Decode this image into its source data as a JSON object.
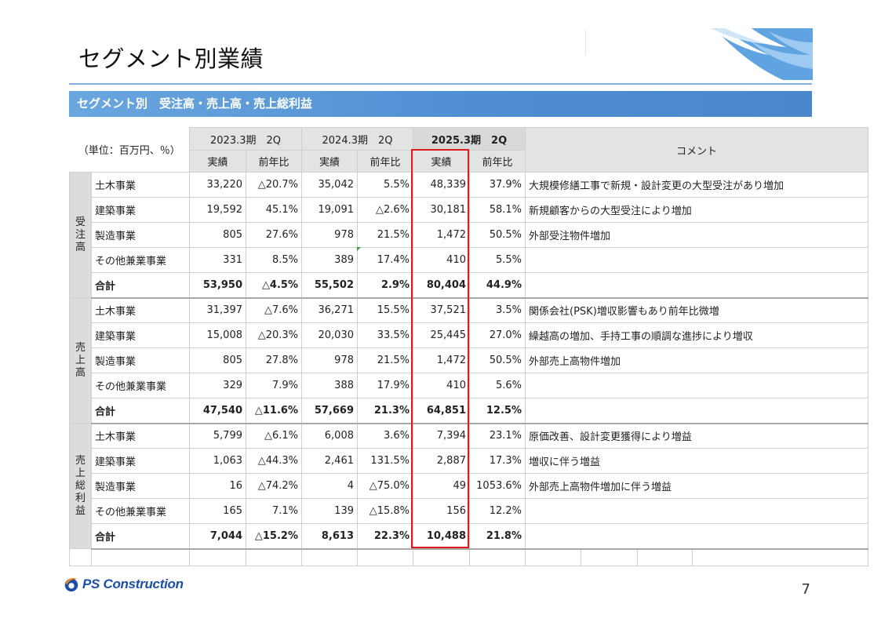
{
  "page": {
    "title": "セグメント別業績",
    "page_number": "7"
  },
  "section": {
    "heading": "セグメント別　受注高・売上高・売上総利益"
  },
  "table": {
    "unit_note": "（単位：百万円、％）",
    "periods": [
      "2023.3期　2Q",
      "2024.3期　2Q",
      "2025.3期　2Q"
    ],
    "sub_headers": {
      "actual": "実績",
      "yoy": "前年比"
    },
    "comment_header": "コメント",
    "groups": [
      {
        "label": "受注高",
        "rows": [
          {
            "segment": "土木事業",
            "v": [
              "33,220",
              "△20.7%",
              "35,042",
              "5.5%",
              "48,339",
              "37.9%"
            ],
            "comment": "大規模修繕工事で新規・設計変更の大型受注があり増加"
          },
          {
            "segment": "建築事業",
            "v": [
              "19,592",
              "45.1%",
              "19,091",
              "△2.6%",
              "30,181",
              "58.1%"
            ],
            "comment": "新規顧客からの大型受注により増加"
          },
          {
            "segment": "製造事業",
            "v": [
              "805",
              "27.6%",
              "978",
              "21.5%",
              "1,472",
              "50.5%"
            ],
            "comment": "外部受注物件増加"
          },
          {
            "segment": "その他兼業事業",
            "v": [
              "331",
              "8.5%",
              "389",
              "17.4%",
              "410",
              "5.5%"
            ],
            "comment": ""
          }
        ],
        "total": {
          "segment": "合計",
          "v": [
            "53,950",
            "△4.5%",
            "55,502",
            "2.9%",
            "80,404",
            "44.9%"
          ],
          "comment": ""
        }
      },
      {
        "label": "売上高",
        "rows": [
          {
            "segment": "土木事業",
            "v": [
              "31,397",
              "△7.6%",
              "36,271",
              "15.5%",
              "37,521",
              "3.5%"
            ],
            "comment": "関係会社(PSK)増収影響もあり前年比微増"
          },
          {
            "segment": "建築事業",
            "v": [
              "15,008",
              "△20.3%",
              "20,030",
              "33.5%",
              "25,445",
              "27.0%"
            ],
            "comment": "繰越高の増加、手持工事の順調な進捗により増収"
          },
          {
            "segment": "製造事業",
            "v": [
              "805",
              "27.8%",
              "978",
              "21.5%",
              "1,472",
              "50.5%"
            ],
            "comment": "外部売上高物件増加"
          },
          {
            "segment": "その他兼業事業",
            "v": [
              "329",
              "7.9%",
              "388",
              "17.9%",
              "410",
              "5.6%"
            ],
            "comment": ""
          }
        ],
        "total": {
          "segment": "合計",
          "v": [
            "47,540",
            "△11.6%",
            "57,669",
            "21.3%",
            "64,851",
            "12.5%"
          ],
          "comment": ""
        }
      },
      {
        "label": "売上総利益",
        "rows": [
          {
            "segment": "土木事業",
            "v": [
              "5,799",
              "△6.1%",
              "6,008",
              "3.6%",
              "7,394",
              "23.1%"
            ],
            "comment": "原価改善、設計変更獲得により増益"
          },
          {
            "segment": "建築事業",
            "v": [
              "1,063",
              "△44.3%",
              "2,461",
              "131.5%",
              "2,887",
              "17.3%"
            ],
            "comment": "増収に伴う増益"
          },
          {
            "segment": "製造事業",
            "v": [
              "16",
              "△74.2%",
              "4",
              "△75.0%",
              "49",
              "1053.6%"
            ],
            "comment": "外部売上高物件増加に伴う増益"
          },
          {
            "segment": "その他兼業事業",
            "v": [
              "165",
              "7.1%",
              "139",
              "△15.8%",
              "156",
              "12.2%"
            ],
            "comment": ""
          }
        ],
        "total": {
          "segment": "合計",
          "v": [
            "7,044",
            "△15.2%",
            "8,613",
            "22.3%",
            "10,488",
            "21.8%"
          ],
          "comment": ""
        }
      }
    ]
  },
  "footer": {
    "logo_text": "PS Construction"
  },
  "colors": {
    "section_bar": "#4f8ed3",
    "title_rule": "#7fb2e4",
    "highlight": "#e0191c",
    "logo": "#1d4fa6",
    "logo_orange": "#f08a1c"
  }
}
